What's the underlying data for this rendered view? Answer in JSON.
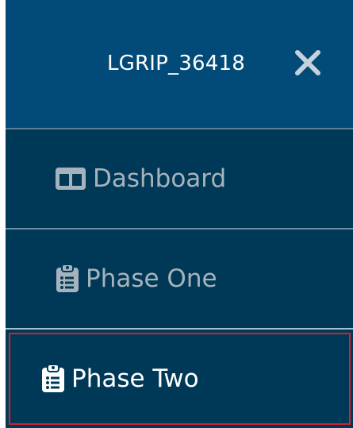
{
  "header": {
    "title": "LGRIP_36418",
    "close_icon": "close-icon"
  },
  "menu": {
    "items": [
      {
        "label": "Dashboard",
        "icon": "columns-icon",
        "active": false
      },
      {
        "label": "Phase One",
        "icon": "clipboard-list-icon",
        "active": false
      },
      {
        "label": "Phase Two",
        "icon": "clipboard-list-icon",
        "active": true
      }
    ]
  },
  "colors": {
    "header_bg": "#024b78",
    "menu_bg": "#003957",
    "muted_text": "#a7b3bc",
    "active_text": "#ffffff",
    "highlight_border": "#d5202a"
  }
}
